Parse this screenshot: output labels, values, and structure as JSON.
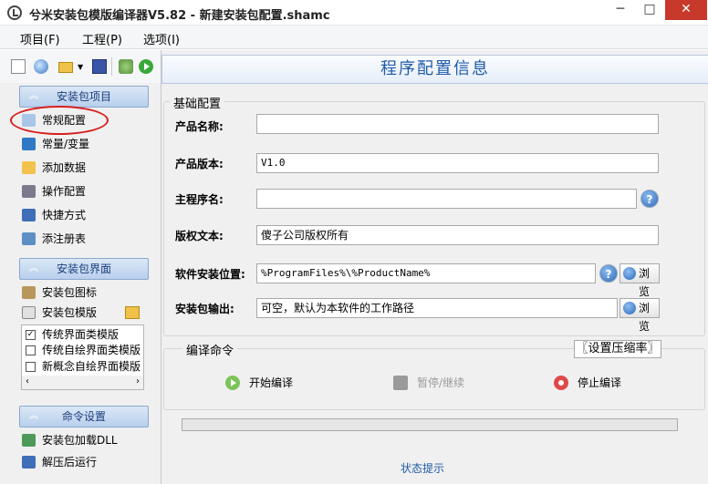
{
  "window": {
    "title": "兮米安装包模版编译器V5.82 - 新建安装包配置.shamc",
    "minimize": "─",
    "maximize": "□",
    "close": "✕"
  },
  "menu": [
    "项目(F)",
    "工程(P)",
    "选项(I)"
  ],
  "sidebar": {
    "project_section": "安装包项目",
    "project_items": [
      "常规配置",
      "常量/变量",
      "添加数据",
      "操作配置",
      "快捷方式",
      "添注册表"
    ],
    "ui_section": "安装包界面",
    "ui_items": [
      "安装包图标",
      "安装包模版"
    ],
    "templates": [
      {
        "label": "传统界面类模版",
        "checked": true
      },
      {
        "label": "传统自绘界面类模版",
        "checked": false
      },
      {
        "label": "新概念自绘界面模版",
        "checked": false
      }
    ],
    "cmd_section": "命令设置",
    "cmd_items": [
      "安装包加载DLL",
      "解压后运行"
    ],
    "selected": "常规配置"
  },
  "main": {
    "title": "程序配置信息",
    "basic_group": "基础配置",
    "fields": {
      "product_name": {
        "label": "产品名称:",
        "value": ""
      },
      "product_version": {
        "label": "产品版本:",
        "value": "V1.0"
      },
      "main_program": {
        "label": "主程序名:",
        "value": ""
      },
      "copyright": {
        "label": "版权文本:",
        "value": "傻子公司版权所有"
      },
      "install_path": {
        "label": "软件安装位置:",
        "value": "%ProgramFiles%\\%ProductName%"
      },
      "output": {
        "label": "安装包输出:",
        "value": "可空，默认为本软件的工作路径"
      }
    },
    "browse_label": "浏览",
    "help_label": "?",
    "compile_group": "编译命令",
    "compress_button": "〖设置压缩率〗",
    "actions": {
      "start": "开始编译",
      "pause": "暂停/继续",
      "stop": "停止编译"
    },
    "progress": 0,
    "status_hint": "状态提示"
  },
  "colors": {
    "accent": "#1e5aa8",
    "highlight": "#d81f1f",
    "close": "#c7392b"
  }
}
